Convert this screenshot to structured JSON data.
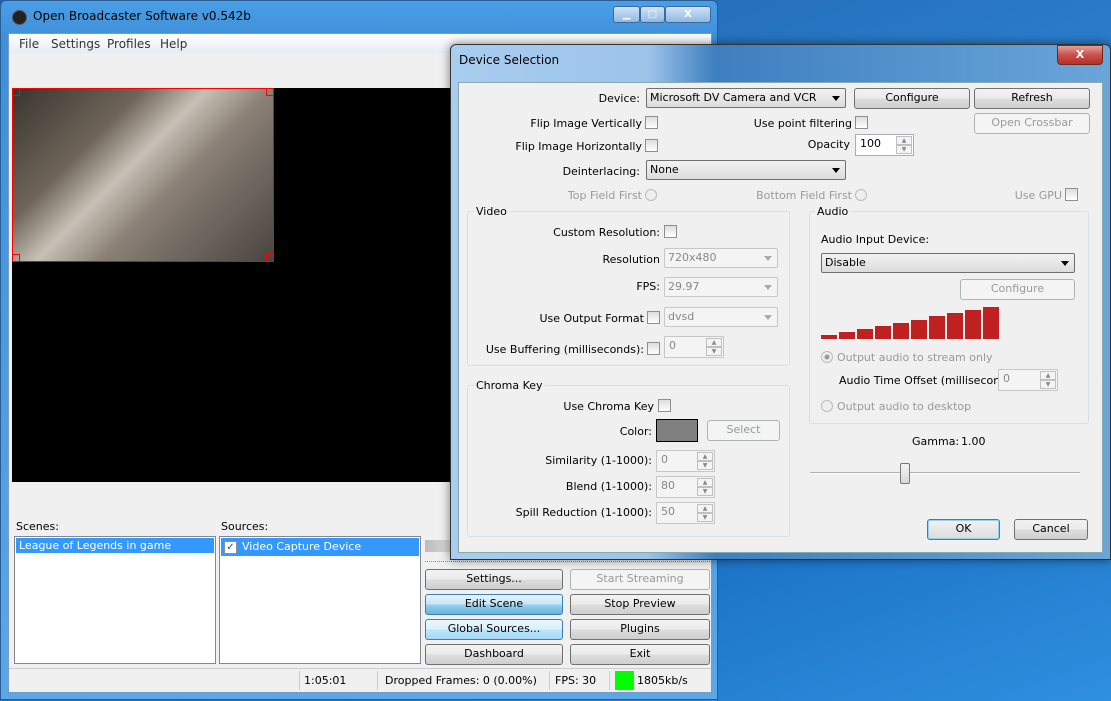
{
  "main": {
    "title": "Open Broadcaster Software v0.542b",
    "controls": {
      "minimize": "▁",
      "maximize": "□",
      "close": "X"
    },
    "menu": [
      "File",
      "Settings",
      "Profiles",
      "Help"
    ],
    "scenes_label": "Scenes:",
    "scenes": [
      "League of Legends in game"
    ],
    "sources_label": "Sources:",
    "sources": [
      {
        "label": "Video Capture Device",
        "checked": true
      }
    ],
    "buttons": {
      "settings": "Settings...",
      "start_streaming": "Start Streaming",
      "edit_scene": "Edit Scene",
      "stop_preview": "Stop Preview",
      "global_sources": "Global Sources...",
      "plugins": "Plugins",
      "dashboard": "Dashboard",
      "exit": "Exit"
    },
    "status": {
      "time": "1:05:01",
      "dropped": "Dropped Frames: 0 (0.00%)",
      "fps": "FPS: 30",
      "bitrate": "1805kb/s",
      "indicator_color": "#00ff00"
    }
  },
  "dialog": {
    "title": "Device Selection",
    "close": "X",
    "device_label": "Device:",
    "device_value": "Microsoft DV Camera and VCR",
    "configure": "Configure",
    "refresh": "Refresh",
    "open_crossbar": "Open Crossbar",
    "flip_v": "Flip Image Vertically",
    "flip_h": "Flip Image Horizontally",
    "point_filtering": "Use point filtering",
    "opacity_label": "Opacity",
    "opacity_value": "100",
    "deinterlacing_label": "Deinterlacing:",
    "deinterlacing_value": "None",
    "top_field": "Top Field First",
    "bottom_field": "Bottom Field First",
    "use_gpu": "Use GPU",
    "video": {
      "title": "Video",
      "custom_res": "Custom Resolution:",
      "resolution_label": "Resolution",
      "resolution_value": "720x480",
      "fps_label": "FPS:",
      "fps_value": "29.97",
      "output_format": "Use Output Format",
      "output_format_value": "dvsd",
      "buffering": "Use Buffering (milliseconds):",
      "buffering_value": "0"
    },
    "chroma": {
      "title": "Chroma Key",
      "use": "Use Chroma Key",
      "color_label": "Color:",
      "color": "#808080",
      "select": "Select",
      "similarity_label": "Similarity (1-1000):",
      "similarity": "0",
      "blend_label": "Blend (1-1000):",
      "blend": "80",
      "spill_label": "Spill Reduction (1-1000):",
      "spill": "50"
    },
    "audio": {
      "title": "Audio",
      "input_label": "Audio Input Device:",
      "input_value": "Disable",
      "configure": "Configure",
      "stream_only": "Output audio to stream only",
      "offset_label": "Audio Time Offset (milliseconds)",
      "offset_value": "0",
      "desktop": "Output audio to desktop",
      "meter_color": "#c02020"
    },
    "gamma_label": "Gamma:",
    "gamma_value": "1.00",
    "gamma_fraction": 0.35,
    "ok": "OK",
    "cancel": "Cancel"
  }
}
